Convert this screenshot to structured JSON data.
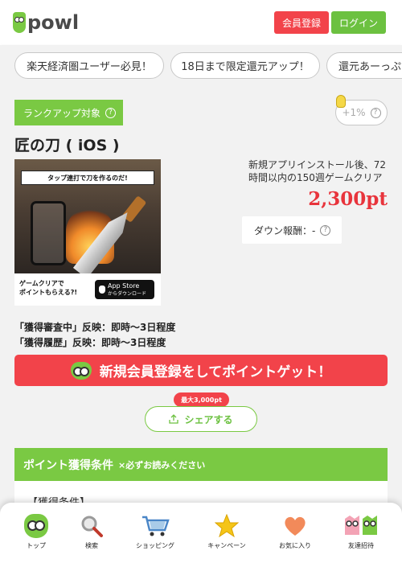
{
  "header": {
    "logo_text": "powl",
    "register_label": "会員登録",
    "login_label": "ログイン"
  },
  "pills": [
    {
      "label": "楽天経済圏ユーザー必見！"
    },
    {
      "label": "18日まで限定還元アップ！"
    },
    {
      "label": "還元あーっぷ"
    }
  ],
  "offer": {
    "rank_badge": "ランクアップ対象",
    "bonus": "+1%",
    "title": "匠の刀 ( iOS )",
    "banner": {
      "caption": "タップ連打で刀を作るのだ!",
      "game_line1": "ゲームクリアで",
      "game_line2": "ポイントもらえる?!",
      "appstore_main": "App Store",
      "appstore_sub": "からダウンロード"
    },
    "description": "新規アプリインストール後、72時間以内の150週ゲームクリア",
    "points": "2,300pt",
    "down_reward": "ダウン報酬：-",
    "reflect_line1": "「獲得審査中」反映：即時～3日程度",
    "reflect_line2": "「獲得履歴」反映：即時～3日程度",
    "cta_label": "新規会員登録をしてポイントゲット！",
    "max_badge": "最大3,000pt",
    "share_label": "シェアする",
    "conditions_title": "ポイント獲得条件",
    "conditions_note": "×必ずお読みください",
    "conditions_label": "【獲得条件】"
  },
  "bottom_nav": [
    {
      "label": "トップ",
      "icon": "owl-icon"
    },
    {
      "label": "検索",
      "icon": "search-icon"
    },
    {
      "label": "ショッピング",
      "icon": "cart-icon"
    },
    {
      "label": "キャンペーン",
      "icon": "star-icon"
    },
    {
      "label": "お気に入り",
      "icon": "heart-icon"
    },
    {
      "label": "友達招待",
      "icon": "friends-icon"
    }
  ],
  "colors": {
    "brand_green": "#7ac943",
    "accent_red": "#f2434a",
    "points_red": "#e8343c"
  }
}
